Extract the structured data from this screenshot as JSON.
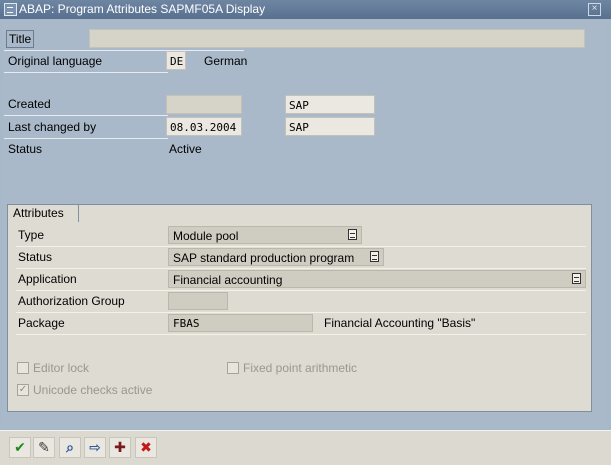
{
  "window": {
    "title": "ABAP: Program Attributes SAPMF05A Display",
    "close_glyph": "×"
  },
  "header": {
    "title_label": "Title",
    "title_value": "",
    "orig_lang_label": "Original language",
    "orig_lang_code": "DE",
    "orig_lang_name": "German",
    "created_label": "Created",
    "created_date": "",
    "created_by": "SAP",
    "changed_label": "Last changed by",
    "changed_date": "08.03.2004",
    "changed_by": "SAP",
    "status_label": "Status",
    "status_value": "Active"
  },
  "attributes": {
    "tab_label": "Attributes",
    "type_label": "Type",
    "type_value": "Module pool",
    "status_label": "Status",
    "status_value": "SAP standard production program",
    "application_label": "Application",
    "application_value": "Financial accounting",
    "auth_label": "Authorization Group",
    "auth_value": "",
    "package_label": "Package",
    "package_value": "FBAS",
    "package_desc": "Financial Accounting \"Basis\"",
    "editor_lock_label": "Editor lock",
    "editor_lock_checked": false,
    "fixed_point_label": "Fixed point arithmetic",
    "fixed_point_checked": false,
    "unicode_label": "Unicode checks active",
    "unicode_checked": true,
    "check_glyph": "✓"
  },
  "toolbar": {
    "buttons": [
      {
        "name": "continue-icon",
        "glyph": "✔",
        "color": "#1f8a1f"
      },
      {
        "name": "edit-pencil-icon",
        "glyph": "✎",
        "color": "#3a3a3a"
      },
      {
        "name": "find-icon",
        "glyph": "⌕",
        "color": "#2a5a9a"
      },
      {
        "name": "forward-icon",
        "glyph": "⇨",
        "color": "#2a5a9a"
      },
      {
        "name": "new-entry-icon",
        "glyph": "✚",
        "color": "#7a1a1a"
      },
      {
        "name": "cancel-icon",
        "glyph": "✖",
        "color": "#c41818"
      }
    ]
  }
}
